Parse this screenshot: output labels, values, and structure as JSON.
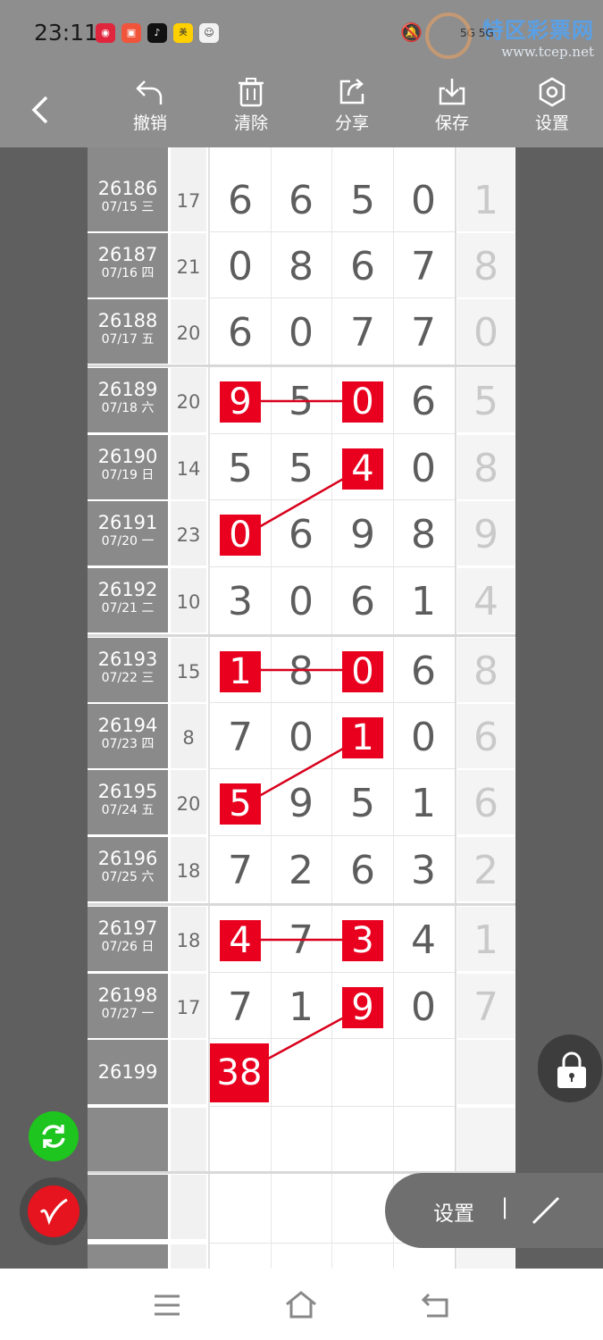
{
  "status_bar": {
    "time": "23:11",
    "indicators": "5G  5G",
    "app_icons": [
      "fan-app-icon",
      "shop-app-icon",
      "tiktok-icon",
      "meituan-icon",
      "avatar-app-icon"
    ]
  },
  "watermark": {
    "line1": "特区彩票网",
    "line2": "www.tcep.net"
  },
  "toolbar": {
    "back_icon": "chevron-left-icon",
    "undo": "撤销",
    "clear": "清除",
    "share": "分享",
    "save": "保存",
    "settings": "设置"
  },
  "rows": [
    {
      "period": "26186",
      "date": "07/15 三",
      "sum": "17",
      "d": [
        "6",
        "6",
        "5",
        "0"
      ],
      "last": "1"
    },
    {
      "period": "26187",
      "date": "07/16 四",
      "sum": "21",
      "d": [
        "0",
        "8",
        "6",
        "7"
      ],
      "last": "8"
    },
    {
      "period": "26188",
      "date": "07/17 五",
      "sum": "20",
      "d": [
        "6",
        "0",
        "7",
        "7"
      ],
      "last": "0"
    },
    {
      "period": "26189",
      "date": "07/18 六",
      "sum": "20",
      "d": [
        "9",
        "5",
        "0",
        "6"
      ],
      "last": "5"
    },
    {
      "period": "26190",
      "date": "07/19 日",
      "sum": "14",
      "d": [
        "5",
        "5",
        "4",
        "0"
      ],
      "last": "8"
    },
    {
      "period": "26191",
      "date": "07/20 一",
      "sum": "23",
      "d": [
        "0",
        "6",
        "9",
        "8"
      ],
      "last": "9"
    },
    {
      "period": "26192",
      "date": "07/21 二",
      "sum": "10",
      "d": [
        "3",
        "0",
        "6",
        "1"
      ],
      "last": "4"
    },
    {
      "period": "26193",
      "date": "07/22 三",
      "sum": "15",
      "d": [
        "1",
        "8",
        "0",
        "6"
      ],
      "last": "8"
    },
    {
      "period": "26194",
      "date": "07/23 四",
      "sum": "8",
      "d": [
        "7",
        "0",
        "1",
        "0"
      ],
      "last": "6"
    },
    {
      "period": "26195",
      "date": "07/24 五",
      "sum": "20",
      "d": [
        "5",
        "9",
        "5",
        "1"
      ],
      "last": "6"
    },
    {
      "period": "26196",
      "date": "07/25 六",
      "sum": "18",
      "d": [
        "7",
        "2",
        "6",
        "3"
      ],
      "last": "2"
    },
    {
      "period": "26197",
      "date": "07/26 日",
      "sum": "18",
      "d": [
        "4",
        "7",
        "3",
        "4"
      ],
      "last": "1"
    },
    {
      "period": "26198",
      "date": "07/27 一",
      "sum": "17",
      "d": [
        "7",
        "1",
        "9",
        "0"
      ],
      "last": "7"
    },
    {
      "period": "26199",
      "date": "",
      "sum": "",
      "d": [
        "",
        "",
        "",
        ""
      ],
      "last": ""
    }
  ],
  "highlight_38": "38",
  "floating": {
    "settings_label": "设置",
    "separator": "|"
  },
  "colors": {
    "highlight": "#e8001e",
    "green_fab": "#1ec51e",
    "red_fab": "#e5141e"
  }
}
